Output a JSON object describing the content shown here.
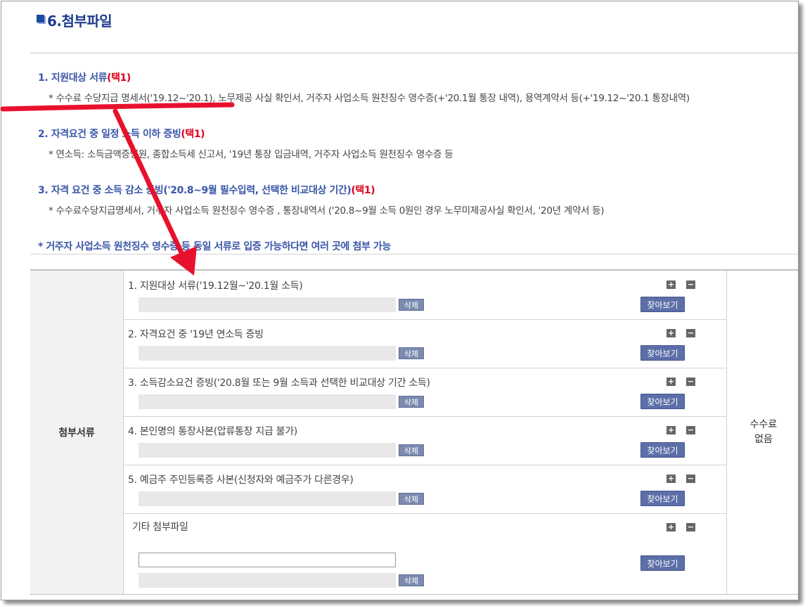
{
  "section": {
    "title": "6.첨부파일"
  },
  "items": [
    {
      "title": "1. 지원대상 서류",
      "pick": "(택1)",
      "desc": "* 수수료 수당지급 명세서('19.12~'20.1), 노무제공 사실 확인서, 거주자 사업소득 원천징수 영수증(+'20.1월 통장 내역), 용역계약서 등(+'19.12~'20.1 통장내역)"
    },
    {
      "title": "2. 자격요건 중 일정 소득 이하 증빙",
      "pick": "(택1)",
      "desc": "* 연소득: 소득금액증명원, 종합소득세 신고서, '19년 통장 입금내역, 거주자 사업소득 원천징수 영수증 등"
    },
    {
      "title": "3. 자격 요건 중 소득 감소 증빙('20.8~9월 필수입력, 선택한 비교대상 기간)",
      "pick": "(택1)",
      "desc": "* 수수료수당지급명세서, 거주자 사업소득 원천징수 영수증 , 통장내역서 ('20.8~9월 소득 0원인 경우 노무미제공사실 확인서, '20년 계약서 등)"
    }
  ],
  "note": "* 거주자 사업소득 원천징수 영수증 등 동일 서류로 입증 가능하다면 여러 곳에 첨부 가능",
  "table": {
    "label": "첨부서류",
    "fee": "수수료\n없음",
    "rows": [
      {
        "label": "1. 지원대상 서류('19.12월~'20.1월 소득)"
      },
      {
        "label": "2. 자격요건 중 '19년 연소득 증빙"
      },
      {
        "label": "3. 소득감소요건 증빙('20.8월 또는 9월 소득과 선택한 비교대상 기간 소득)"
      },
      {
        "label": "4. 본인명의 통장사본(압류통장 지급 불가)"
      },
      {
        "label": "5. 예금주 주민등록증 사본(신청자와 예금주가 다른경우)"
      }
    ],
    "etc_label": "기타 첨부파일",
    "delete_label": "삭제",
    "browse_label": "찾아보기",
    "plus_label": "+",
    "minus_label": "−"
  },
  "colors": {
    "accent": "#3a56a8",
    "pick": "#e0001b",
    "annotation": "#e8112d"
  }
}
